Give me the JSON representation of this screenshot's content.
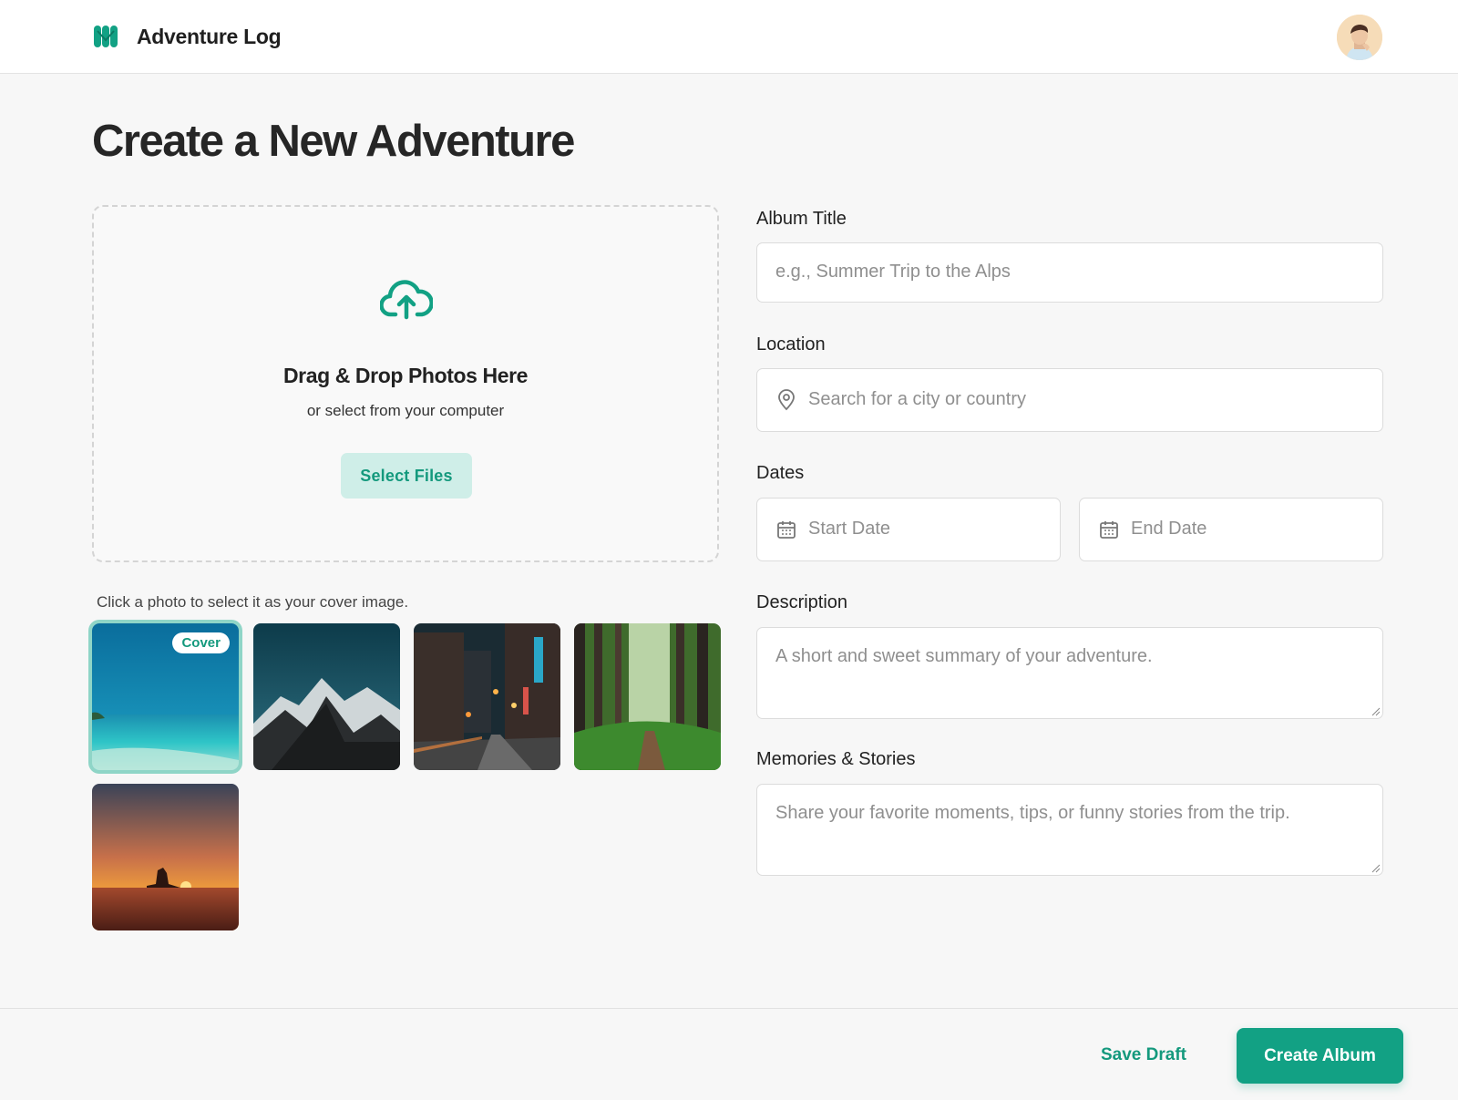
{
  "app": {
    "name": "Adventure Log",
    "logo_icon": "brand-logo-icon",
    "avatar_icon": "user-avatar"
  },
  "page": {
    "title": "Create a New Adventure"
  },
  "dropzone": {
    "icon": "cloud-upload-icon",
    "title": "Drag & Drop Photos Here",
    "subtitle": "or select from your computer",
    "button_label": "Select Files"
  },
  "gallery": {
    "hint": "Click a photo to select it as your cover image.",
    "cover_badge": "Cover",
    "photos": [
      {
        "subject": "beach",
        "selected": true
      },
      {
        "subject": "mountains",
        "selected": false
      },
      {
        "subject": "city-street-night",
        "selected": false
      },
      {
        "subject": "forest-path",
        "selected": false
      },
      {
        "subject": "desert-sunset",
        "selected": false
      }
    ]
  },
  "form": {
    "album_title": {
      "label": "Album Title",
      "placeholder": "e.g., Summer Trip to the Alps",
      "value": ""
    },
    "location": {
      "label": "Location",
      "placeholder": "Search for a city or country",
      "value": "",
      "icon": "map-pin-icon"
    },
    "dates": {
      "label": "Dates",
      "start": {
        "placeholder": "Start Date",
        "value": "",
        "icon": "calendar-icon"
      },
      "end": {
        "placeholder": "End Date",
        "value": "",
        "icon": "calendar-icon"
      }
    },
    "description": {
      "label": "Description",
      "placeholder": "A short and sweet summary of your adventure.",
      "value": ""
    },
    "memories": {
      "label": "Memories & Stories",
      "placeholder": "Share your favorite moments, tips, or funny stories from the trip.",
      "value": ""
    }
  },
  "footer": {
    "save_draft_label": "Save Draft",
    "create_label": "Create Album"
  },
  "colors": {
    "accent": "#12a184",
    "accent_light": "#cfeee8",
    "background": "#f7f7f7"
  }
}
